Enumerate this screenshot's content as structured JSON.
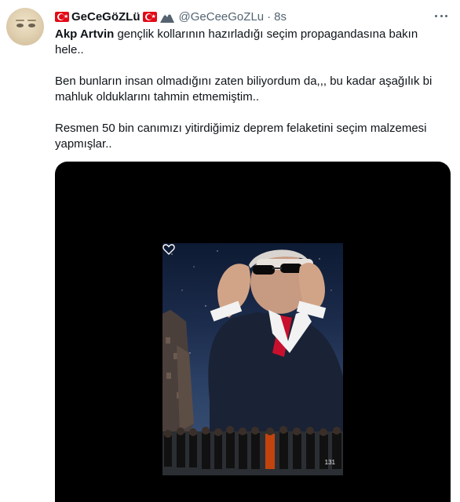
{
  "tweet": {
    "author": {
      "display_name": "GeCeGöZLü",
      "handle": "@GeCeeGoZLu",
      "time": "8s",
      "icons": [
        "turkish-flag-icon",
        "turkish-flag-icon",
        "mountain-icon"
      ]
    },
    "text": {
      "mention": "Akp Artvin",
      "line1_rest": " gençlik kollarının hazırladığı seçim propagandasına bakın hele..",
      "para2": "Ben bunların insan olmadığını zaten biliyordum da,,, bu kadar aşağılık bi mahluk olduklarını tahmin etmemiştim..",
      "para3": "Resmen 50 bin canımızı yitirdiğimiz deprem felaketini seçim malzemesi yapmışlar.."
    },
    "media": {
      "type": "video",
      "view_count": "131",
      "icons": [
        "heart-icon"
      ]
    },
    "colors": {
      "text": "#0f1419",
      "secondary": "#536471",
      "flag_red": "#e30a17",
      "media_bg": "#000000"
    }
  }
}
